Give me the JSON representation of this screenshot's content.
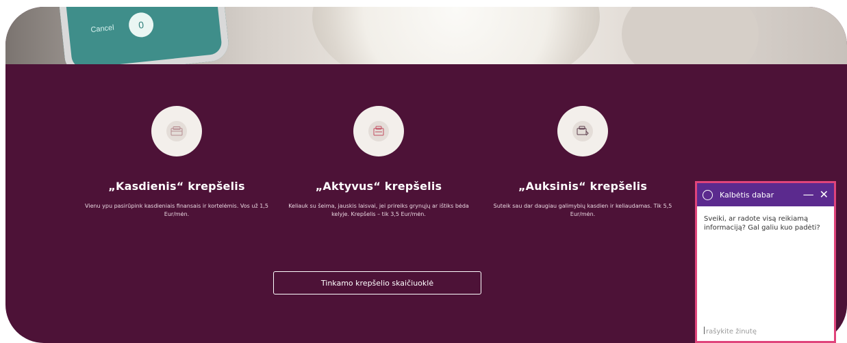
{
  "hero": {
    "phone_cancel": "Cancel",
    "phone_value": "0"
  },
  "features": [
    {
      "title": "„Kasdienis“ krepšelis",
      "desc": "Vienu ypu pasirūpink kasdieniais finansais ir kortelėmis. Vos už 1,5 Eur/mėn.",
      "icon": "wallet-icon"
    },
    {
      "title": "„Aktyvus“ krepšelis",
      "desc": "Keliauk su šeima, jauskis laisvai, jei prireiks grynųjų ar ištiks bėda kelyje. Krepšelis – tik 3,5 Eur/mėn.",
      "icon": "travel-cards-icon"
    },
    {
      "title": "„Auksinis“ krepšelis",
      "desc": "Suteik sau dar daugiau galimybių kasdien ir keliaudamas. Tik 5,5 Eur/mėn.",
      "icon": "gold-cards-icon"
    }
  ],
  "calculator_button": "Tinkamo krepšelio skaičiuoklė",
  "chat": {
    "title": "Kalbėtis dabar",
    "minimize": "—",
    "close": "✕",
    "message": "Sveiki, ar radote visą reikiamą informaciją? Gal galiu kuo padėti?",
    "input_placeholder": "rašykite žinutę"
  },
  "colors": {
    "background": "#4d1237",
    "chat_header": "#5b2a8e",
    "chat_border": "#e0447b"
  }
}
